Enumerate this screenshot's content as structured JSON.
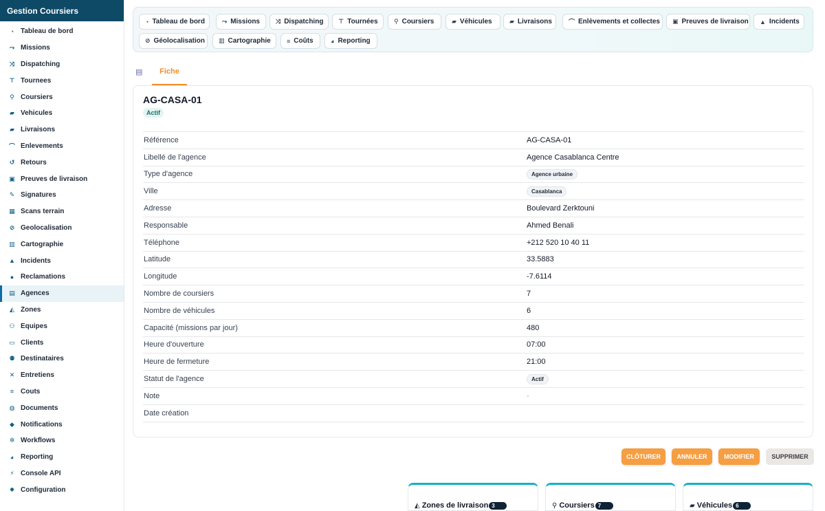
{
  "sidebar": {
    "title": "Gestion Coursiers",
    "items": [
      {
        "label": "Tableau de bord",
        "icon": "dashboard-icon",
        "glyph": "◔",
        "active": false
      },
      {
        "label": "Missions",
        "icon": "missions-icon",
        "glyph": "⤳",
        "active": false
      },
      {
        "label": "Dispatching",
        "icon": "shuffle-icon",
        "glyph": "⤨",
        "active": false
      },
      {
        "label": "Tournees",
        "icon": "signpost-icon",
        "glyph": "⊤",
        "active": false
      },
      {
        "label": "Coursiers",
        "icon": "bicycle-icon",
        "glyph": "⚲",
        "active": false
      },
      {
        "label": "Vehicules",
        "icon": "truck-icon",
        "glyph": "▰",
        "active": false
      },
      {
        "label": "Livraisons",
        "icon": "delivery-truck-icon",
        "glyph": "▰",
        "active": false
      },
      {
        "label": "Enlevements",
        "icon": "pickup-icon",
        "glyph": "⌒",
        "active": false
      },
      {
        "label": "Retours",
        "icon": "return-icon",
        "glyph": "↺",
        "active": false
      },
      {
        "label": "Preuves de livraison",
        "icon": "clipboard-check-icon",
        "glyph": "▣",
        "active": false
      },
      {
        "label": "Signatures",
        "icon": "signature-icon",
        "glyph": "✎",
        "active": false
      },
      {
        "label": "Scans terrain",
        "icon": "barcode-icon",
        "glyph": "▦",
        "active": false
      },
      {
        "label": "Geolocalisation",
        "icon": "satellite-icon",
        "glyph": "⊘",
        "active": false
      },
      {
        "label": "Cartographie",
        "icon": "map-icon",
        "glyph": "▥",
        "active": false
      },
      {
        "label": "Incidents",
        "icon": "warning-icon",
        "glyph": "▲",
        "active": false
      },
      {
        "label": "Reclamations",
        "icon": "comment-icon",
        "glyph": "●",
        "active": false
      },
      {
        "label": "Agences",
        "icon": "building-icon",
        "glyph": "▤",
        "active": true
      },
      {
        "label": "Zones",
        "icon": "map-location-icon",
        "glyph": "◭",
        "active": false
      },
      {
        "label": "Equipes",
        "icon": "users-icon",
        "glyph": "⚇",
        "active": false
      },
      {
        "label": "Clients",
        "icon": "briefcase-icon",
        "glyph": "▭",
        "active": false
      },
      {
        "label": "Destinataires",
        "icon": "user-tag-icon",
        "glyph": "⚉",
        "active": false
      },
      {
        "label": "Entretiens",
        "icon": "tools-icon",
        "glyph": "✕",
        "active": false
      },
      {
        "label": "Couts",
        "icon": "coins-icon",
        "glyph": "≡",
        "active": false
      },
      {
        "label": "Documents",
        "icon": "folder-icon",
        "glyph": "◍",
        "active": false
      },
      {
        "label": "Notifications",
        "icon": "bell-icon",
        "glyph": "◆",
        "active": false
      },
      {
        "label": "Workflows",
        "icon": "gears-icon",
        "glyph": "✲",
        "active": false
      },
      {
        "label": "Reporting",
        "icon": "pie-chart-icon",
        "glyph": "◕",
        "active": false
      },
      {
        "label": "Console API",
        "icon": "plug-icon",
        "glyph": "⚡",
        "active": false
      },
      {
        "label": "Configuration",
        "icon": "gear-icon",
        "glyph": "✹",
        "active": false
      }
    ]
  },
  "quick_tabs": [
    {
      "label": "Tableau de bord",
      "icon": "dashboard-icon",
      "glyph": "◔"
    },
    {
      "label": "Missions",
      "icon": "missions-icon",
      "glyph": "⤳"
    },
    {
      "label": "Dispatching",
      "icon": "shuffle-icon",
      "glyph": "⤨"
    },
    {
      "label": "Tournées",
      "icon": "signpost-icon",
      "glyph": "⊤"
    },
    {
      "label": "Coursiers",
      "icon": "bicycle-icon",
      "glyph": "⚲"
    },
    {
      "label": "Véhicules",
      "icon": "truck-icon",
      "glyph": "▰"
    },
    {
      "label": "Livraisons",
      "icon": "delivery-truck-icon",
      "glyph": "▰"
    },
    {
      "label": "Enlèvements et collectes",
      "icon": "pickup-icon",
      "glyph": "⌒"
    },
    {
      "label": "Preuves de livraison",
      "icon": "clipboard-check-icon",
      "glyph": "▣"
    },
    {
      "label": "Incidents",
      "icon": "warning-icon",
      "glyph": "▲"
    },
    {
      "label": "Géolocalisation",
      "icon": "satellite-icon",
      "glyph": "⊘"
    },
    {
      "label": "Cartographie",
      "icon": "map-icon",
      "glyph": "▥"
    },
    {
      "label": "Coûts",
      "icon": "coins-icon",
      "glyph": "≡"
    },
    {
      "label": "Reporting",
      "icon": "pie-chart-icon",
      "glyph": "◕"
    }
  ],
  "detail_tabs": [
    {
      "label": "Fiche",
      "active": true
    }
  ],
  "record": {
    "title": "AG-CASA-01",
    "status_badge": "Actif",
    "fields": [
      {
        "label": "Référence",
        "value": "AG-CASA-01",
        "type": "text"
      },
      {
        "label": "Libellé de l'agence",
        "value": "Agence Casablanca Centre",
        "type": "text"
      },
      {
        "label": "Type d'agence",
        "value": "Agence urbaine",
        "type": "pill"
      },
      {
        "label": "Ville",
        "value": "Casablanca",
        "type": "pill"
      },
      {
        "label": "Adresse",
        "value": "Boulevard Zerktouni",
        "type": "text"
      },
      {
        "label": "Responsable",
        "value": "Ahmed Benali",
        "type": "text"
      },
      {
        "label": "Téléphone",
        "value": "+212 520 10 40 11",
        "type": "text"
      },
      {
        "label": "Latitude",
        "value": "33.5883",
        "type": "text"
      },
      {
        "label": "Longitude",
        "value": "-7.6114",
        "type": "text"
      },
      {
        "label": "Nombre de coursiers",
        "value": "7",
        "type": "text"
      },
      {
        "label": "Nombre de véhicules",
        "value": "6",
        "type": "text"
      },
      {
        "label": "Capacité (missions par jour)",
        "value": "480",
        "type": "text"
      },
      {
        "label": "Heure d'ouverture",
        "value": "07:00",
        "type": "text"
      },
      {
        "label": "Heure de fermeture",
        "value": "21:00",
        "type": "text"
      },
      {
        "label": "Statut de l'agence",
        "value": "Actif",
        "type": "pill"
      },
      {
        "label": "Note",
        "value": "-",
        "type": "muted"
      },
      {
        "label": "Date création",
        "value": "",
        "type": "text"
      }
    ]
  },
  "actions": {
    "close_label": "CLÔTURER",
    "cancel_label": "ANNULER",
    "edit_label": "MODIFIER",
    "delete_label": "SUPPRIMER"
  },
  "related": [
    {
      "title": "Zones de livraison",
      "count": "3",
      "icon": "map-location-icon",
      "glyph": "◭"
    },
    {
      "title": "Coursiers",
      "count": "7",
      "icon": "bicycle-icon",
      "glyph": "⚲"
    },
    {
      "title": "Véhicules",
      "count": "6",
      "icon": "truck-icon",
      "glyph": "▰"
    }
  ],
  "colors": {
    "brand": "#0e4a66",
    "accent": "#f59e42",
    "active_tab": "#f28c28",
    "related_card_top": "#12b0c9"
  }
}
